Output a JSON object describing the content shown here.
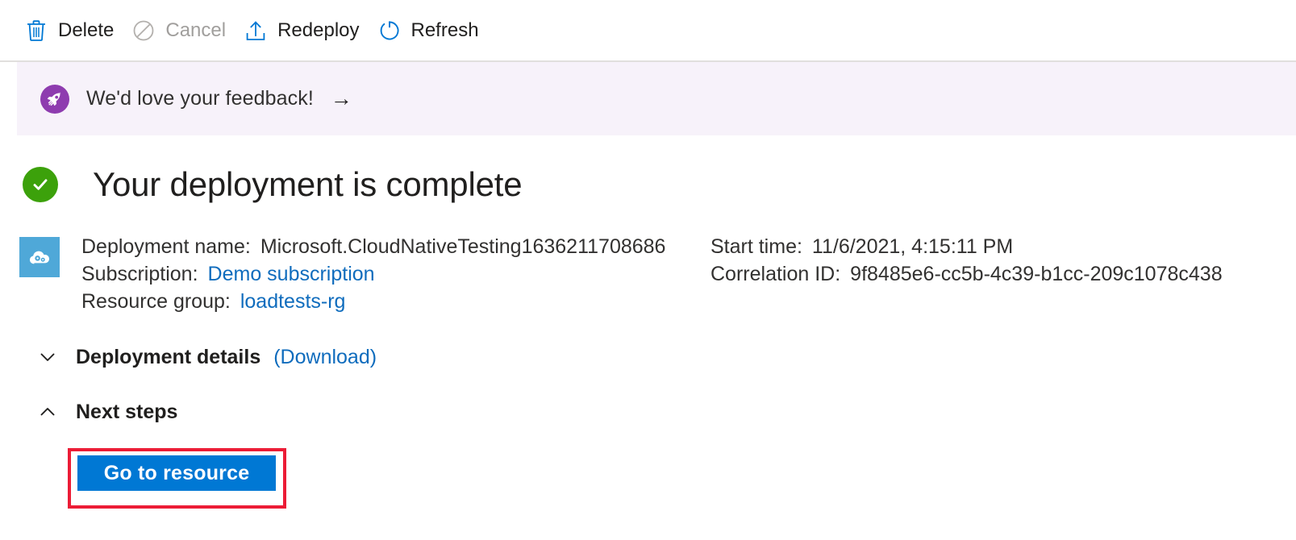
{
  "toolbar": {
    "buttons": [
      {
        "label": "Delete",
        "icon": "trash-icon",
        "disabled": false
      },
      {
        "label": "Cancel",
        "icon": "cancel-icon",
        "disabled": true
      },
      {
        "label": "Redeploy",
        "icon": "redeploy-upload-icon",
        "disabled": false
      },
      {
        "label": "Refresh",
        "icon": "refresh-icon",
        "disabled": false
      }
    ]
  },
  "feedback_banner": {
    "icon": "rocket-icon",
    "text": "We'd love your feedback!",
    "arrow": "→",
    "background_color": "#f7f2fa",
    "icon_background_color": "#8e3caf"
  },
  "status": {
    "icon": "success-check-icon",
    "icon_color": "#3ca10b",
    "title": "Your deployment is complete"
  },
  "deployment_info": {
    "icon": "cloud-deployment-icon",
    "icon_background_color": "#4fa8d8",
    "left": [
      {
        "label": "Deployment name:",
        "value": "Microsoft.CloudNativeTesting1636211708686",
        "is_link": false
      },
      {
        "label": "Subscription:",
        "value": "Demo subscription",
        "is_link": true
      },
      {
        "label": "Resource group:",
        "value": "loadtests-rg",
        "is_link": true
      }
    ],
    "right": [
      {
        "label": "Start time:",
        "value": "11/6/2021, 4:15:11 PM",
        "is_link": false
      },
      {
        "label": "Correlation ID:",
        "value": "9f8485e6-cc5b-4c39-b1cc-209c1078c438",
        "is_link": false
      }
    ]
  },
  "sections": {
    "deployment_details": {
      "title": "Deployment details",
      "sublink": "(Download)",
      "chevron": "chevron-down-icon",
      "expanded": false
    },
    "next_steps": {
      "title": "Next steps",
      "chevron": "chevron-up-icon",
      "expanded": true
    }
  },
  "actions": {
    "go_to_resource_label": "Go to resource",
    "primary_color": "#0078d4",
    "annotation_color": "#ec1c36"
  }
}
